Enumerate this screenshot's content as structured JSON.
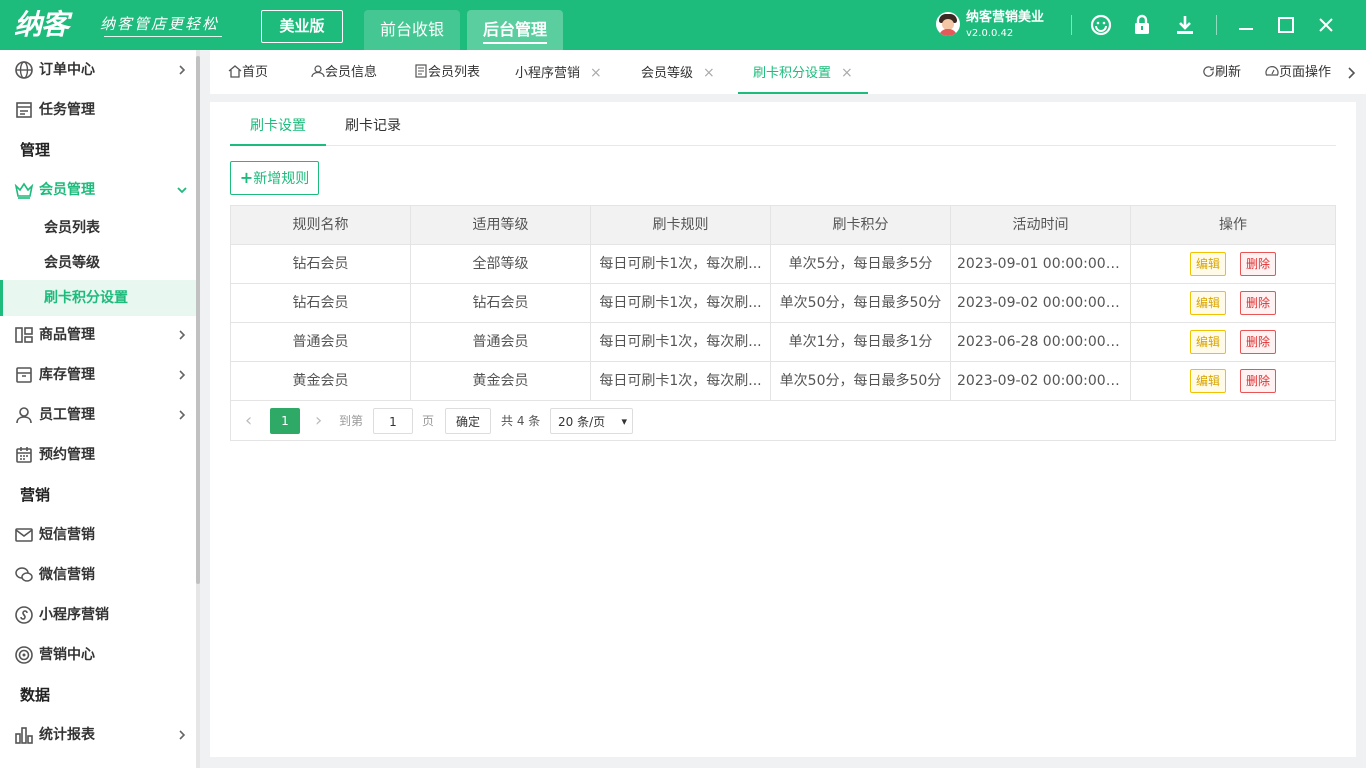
{
  "topbar": {
    "logo": "纳客",
    "slogan": "纳客管店更轻松",
    "edition": "美业版",
    "tabs": [
      "前台收银",
      "后台管理"
    ],
    "user_name": "纳客营销美业",
    "version": "v2.0.0.42"
  },
  "sidebar": {
    "items": [
      {
        "label": "订单中心"
      },
      {
        "label": "任务管理"
      },
      {
        "label": "管理"
      },
      {
        "label": "会员管理"
      },
      {
        "label": "会员列表"
      },
      {
        "label": "会员等级"
      },
      {
        "label": "刷卡积分设置"
      },
      {
        "label": "商品管理"
      },
      {
        "label": "库存管理"
      },
      {
        "label": "员工管理"
      },
      {
        "label": "预约管理"
      },
      {
        "label": "营销"
      },
      {
        "label": "短信营销"
      },
      {
        "label": "微信营销"
      },
      {
        "label": "小程序营销"
      },
      {
        "label": "营销中心"
      },
      {
        "label": "数据"
      },
      {
        "label": "统计报表"
      }
    ]
  },
  "page_tabs": {
    "tabs": [
      "首页",
      "会员信息",
      "会员列表",
      "小程序营销",
      "会员等级",
      "刷卡积分设置"
    ],
    "refresh": "刷新",
    "page_ops": "页面操作",
    "close_glyph": "×"
  },
  "inner_tabs": [
    "刷卡设置",
    "刷卡记录"
  ],
  "add_button": "新增规则",
  "table": {
    "headers": [
      "规则名称",
      "适用等级",
      "刷卡规则",
      "刷卡积分",
      "活动时间",
      "操作"
    ],
    "rows": [
      [
        "钻石会员",
        "全部等级",
        "每日可刷卡1次，每次刷...",
        "单次5分，每日最多5分",
        "2023-09-01 00:00:00 - 2..."
      ],
      [
        "钻石会员",
        "钻石会员",
        "每日可刷卡1次，每次刷...",
        "单次50分，每日最多50分",
        "2023-09-02 00:00:00 - 2..."
      ],
      [
        "普通会员",
        "普通会员",
        "每日可刷卡1次，每次刷...",
        "单次1分，每日最多1分",
        "2023-06-28 00:00:00 - 2..."
      ],
      [
        "黄金会员",
        "黄金会员",
        "每日可刷卡1次，每次刷...",
        "单次50分，每日最多50分",
        "2023-09-02 00:00:00 - 2..."
      ]
    ],
    "edit_label": "编辑",
    "delete_label": "删除"
  },
  "pagination": {
    "prev": "‹",
    "current_page": "1",
    "next": "›",
    "goto_label": "到第",
    "goto_value": "1",
    "page_suffix": "页",
    "confirm": "确定",
    "total": "共 4 条",
    "page_size": "20 条/页",
    "dropdown_glyph": "▾"
  },
  "colors": {
    "brand": "#1dbb7c",
    "page_current": "#2ea966",
    "edit": "#d9a400",
    "delete": "#e03030"
  }
}
